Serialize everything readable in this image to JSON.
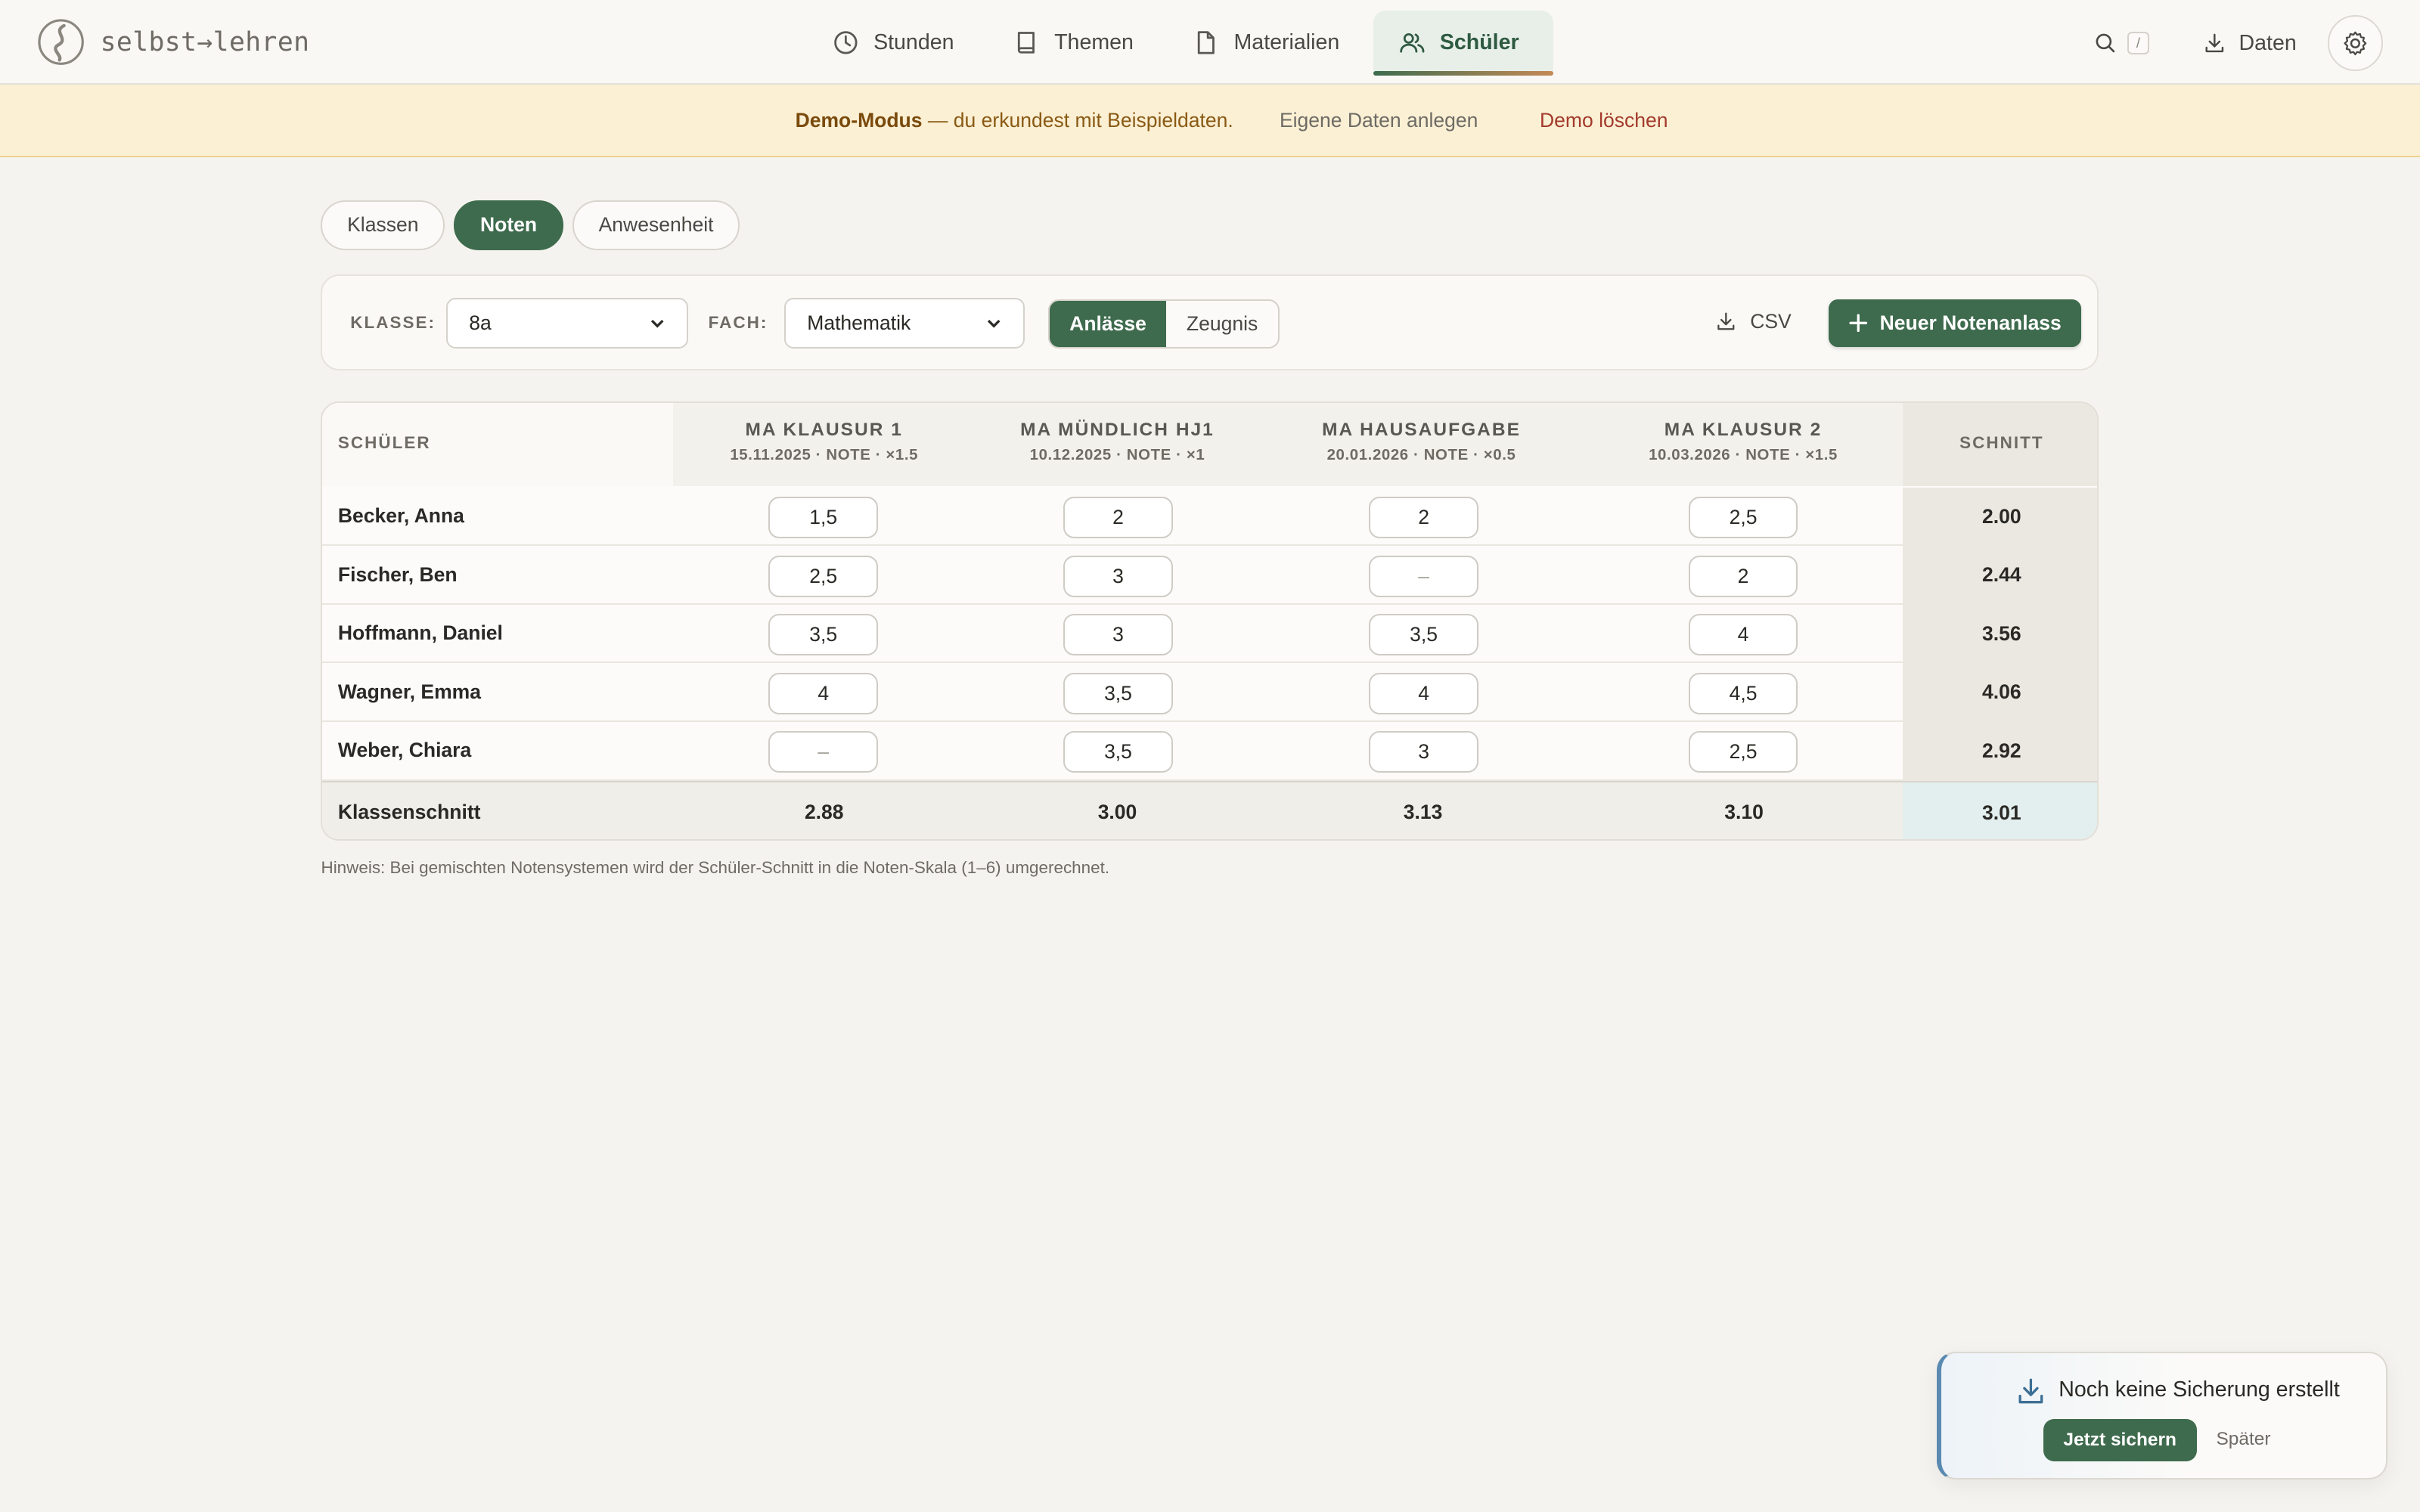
{
  "brand": {
    "name": "selbst→lehren"
  },
  "nav": {
    "items": [
      {
        "label": "Stunden",
        "icon": "clock-icon"
      },
      {
        "label": "Themen",
        "icon": "book-icon"
      },
      {
        "label": "Materialien",
        "icon": "document-icon"
      },
      {
        "label": "Schüler",
        "icon": "users-icon",
        "active": true
      }
    ],
    "search_shortcut": "/",
    "data_label": "Daten"
  },
  "banner": {
    "mode_label": "Demo-Modus",
    "message": " — du erkundest mit Beispieldaten.",
    "create_label": "Eigene Daten anlegen",
    "delete_label": "Demo löschen"
  },
  "subtabs": [
    {
      "label": "Klassen"
    },
    {
      "label": "Noten",
      "active": true
    },
    {
      "label": "Anwesenheit"
    }
  ],
  "filters": {
    "class_label": "KLASSE:",
    "class_value": "8a",
    "subject_label": "FACH:",
    "subject_value": "Mathematik",
    "view_options": [
      "Anlässe",
      "Zeugnis"
    ],
    "view_selected": "Anlässe",
    "csv_label": "CSV",
    "new_label": "Neuer Notenanlass"
  },
  "table": {
    "student_header": "SCHÜLER",
    "average_header": "SCHNITT",
    "columns": [
      {
        "title": "MA KLAUSUR 1",
        "meta": "15.11.2025 · NOTE · ×1.5"
      },
      {
        "title": "MA MÜNDLICH HJ1",
        "meta": "10.12.2025 · NOTE · ×1"
      },
      {
        "title": "MA HAUSAUFGABE",
        "meta": "20.01.2026 · NOTE · ×0.5"
      },
      {
        "title": "MA KLAUSUR 2",
        "meta": "10.03.2026 · NOTE · ×1.5"
      }
    ],
    "rows": [
      {
        "name": "Becker, Anna",
        "grades": [
          "1,5",
          "2",
          "2",
          "2,5"
        ],
        "avg": "2.00"
      },
      {
        "name": "Fischer, Ben",
        "grades": [
          "2,5",
          "3",
          "–",
          "2"
        ],
        "avg": "2.44"
      },
      {
        "name": "Hoffmann, Daniel",
        "grades": [
          "3,5",
          "3",
          "3,5",
          "4"
        ],
        "avg": "3.56"
      },
      {
        "name": "Wagner, Emma",
        "grades": [
          "4",
          "3,5",
          "4",
          "4,5"
        ],
        "avg": "4.06"
      },
      {
        "name": "Weber, Chiara",
        "grades": [
          "–",
          "3,5",
          "3",
          "2,5"
        ],
        "avg": "2.92"
      }
    ],
    "footer": {
      "label": "Klassenschnitt",
      "values": [
        "2.88",
        "3.00",
        "3.13",
        "3.10"
      ],
      "avg": "3.01"
    }
  },
  "hint": "Hinweis: Bei gemischten Notensystemen wird der Schüler-Schnitt in die Noten-Skala (1–6) umgerechnet.",
  "toast": {
    "title": "Noch keine Sicherung erstellt",
    "primary_label": "Jetzt sichern",
    "secondary_label": "Später"
  },
  "colors": {
    "accent": "#3e6b4d",
    "banner_bg": "#fbf0d4",
    "danger": "#a33a2c",
    "toast_accent": "#5a8ab2"
  }
}
